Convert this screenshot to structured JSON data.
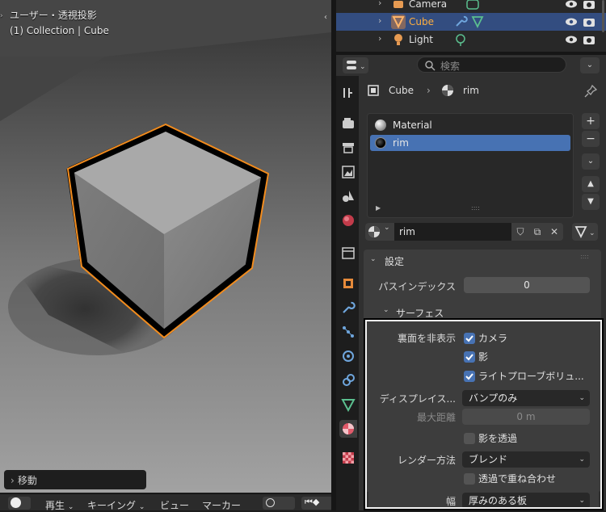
{
  "viewport": {
    "view_name": "ユーザー・透視投影",
    "collection_info": "(1) Collection | Cube",
    "last_operator": "移動"
  },
  "timeline": {
    "play": "再生",
    "keying": "キーイング",
    "view": "ビュー",
    "marker": "マーカー"
  },
  "outliner": {
    "rows": [
      {
        "label": "Camera"
      },
      {
        "label": "Cube"
      },
      {
        "label": "Light"
      }
    ]
  },
  "properties": {
    "search_placeholder": "検索",
    "breadcrumb_object": "Cube",
    "breadcrumb_material": "rim",
    "slots": [
      {
        "label": "Material"
      },
      {
        "label": "rim"
      }
    ],
    "material_name": "rim",
    "settings_panel": {
      "title": "設定",
      "pass_index_label": "パスインデックス",
      "pass_index_value": "0",
      "surface_subpanel": "サーフェス",
      "backface_label": "裏面を非表示",
      "backface_camera": "カメラ",
      "backface_shadow": "影",
      "backface_lightprobe": "ライトプローブボリュ...",
      "displacement_label": "ディスプレイス...",
      "displacement_value": "バンプのみ",
      "max_distance_label": "最大距離",
      "max_distance_value": "0 m",
      "transparent_shadow": "影を透過",
      "render_method_label": "レンダー方法",
      "render_method_value": "ブレンド",
      "transparency_overlap": "透過で重ね合わせ",
      "thickness_label": "幅",
      "thickness_value": "厚みのある板"
    }
  },
  "colors": {
    "selection": "#4772b3",
    "active_object": "#ffaf3f",
    "outline": "#f28c1e"
  }
}
